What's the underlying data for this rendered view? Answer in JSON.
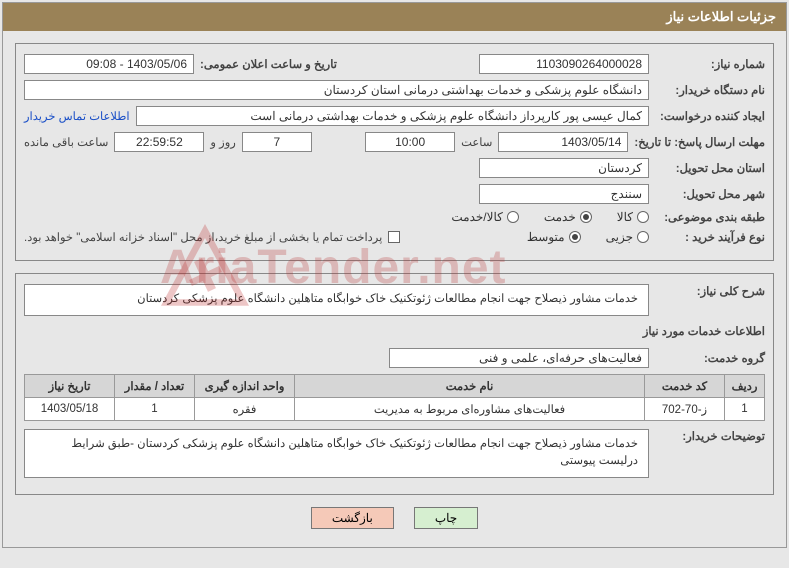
{
  "header": {
    "title": "جزئیات اطلاعات نیاز"
  },
  "watermark": "AriaTender.net",
  "panel1": {
    "need_number_label": "شماره نیاز:",
    "need_number": "1103090264000028",
    "public_time_label": "تاریخ و ساعت اعلان عمومی:",
    "public_time": "1403/05/06 - 09:08",
    "buyer_label": "نام دستگاه خریدار:",
    "buyer": "دانشگاه علوم پزشکی و خدمات بهداشتی  درمانی استان کردستان",
    "creator_label": "ایجاد کننده درخواست:",
    "creator": "کمال عیسی پور کارپرداز دانشگاه علوم پزشکی و خدمات بهداشتی  درمانی است",
    "contact_link": "اطلاعات تماس خریدار",
    "deadline_label": "مهلت ارسال پاسخ: تا تاریخ:",
    "deadline_date": "1403/05/14",
    "time_label": "ساعت",
    "deadline_time": "10:00",
    "days": "7",
    "days_label": "روز و",
    "countdown": "22:59:52",
    "remaining_label": "ساعت باقی مانده",
    "province_label": "استان محل تحویل:",
    "province": "کردستان",
    "city_label": "شهر محل تحویل:",
    "city": "سنندج",
    "category_label": "طبقه بندی موضوعی:",
    "cat_kala": "کالا",
    "cat_khedmat": "خدمت",
    "cat_kalakhedmat": "کالا/خدمت",
    "buy_type_label": "نوع فرآیند خرید :",
    "buy_jozei": "جزیی",
    "buy_motevaset": "متوسط",
    "payment_note": "پرداخت تمام یا بخشی از مبلغ خرید،از محل \"اسناد خزانه اسلامی\" خواهد بود."
  },
  "panel2": {
    "summary_label": "شرح کلی نیاز:",
    "summary": "خدمات مشاور ذیصلاح جهت انجام مطالعات ژئوتکنیک خاک خوابگاه متاهلین دانشگاه علوم پزشکی کردستان",
    "info_label": "اطلاعات خدمات مورد نیاز",
    "group_label": "گروه خدمت:",
    "group": "فعالیت‌های حرفه‌ای، علمی و فنی",
    "table": {
      "headers": [
        "ردیف",
        "کد خدمت",
        "نام خدمت",
        "واحد اندازه گیری",
        "تعداد / مقدار",
        "تاریخ نیاز"
      ],
      "rows": [
        {
          "radif": "1",
          "code": "ز-70-702",
          "name": "فعالیت‌های مشاوره‌ای مربوط به مدیریت",
          "unit": "فقره",
          "qty": "1",
          "date": "1403/05/18"
        }
      ]
    },
    "desc_label": "توضیحات خریدار:",
    "desc": "خدمات مشاور ذیصلاح جهت انجام مطالعات ژئوتکنیک خاک خوابگاه متاهلین دانشگاه علوم پزشکی کردستان -طبق شرایط درلیست پیوستی"
  },
  "buttons": {
    "print": "چاپ",
    "back": "بازگشت"
  }
}
